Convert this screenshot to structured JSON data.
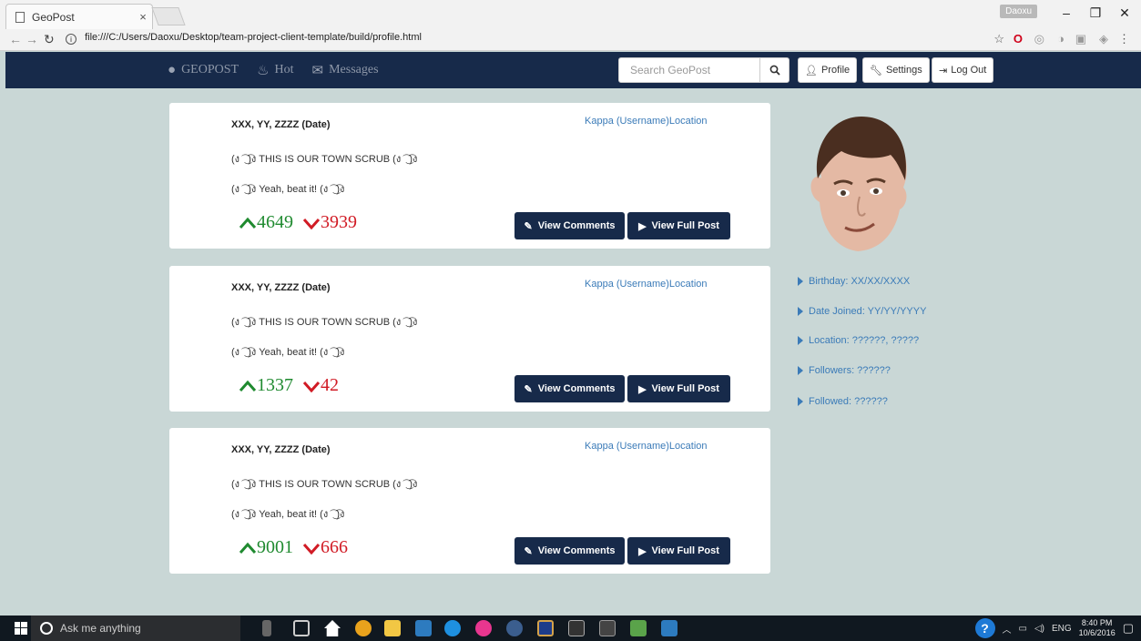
{
  "browser": {
    "tab_title": "GeoPost",
    "tab_close": "×",
    "url": "file:///C:/Users/Daoxu/Desktop/team-project-client-template/build/profile.html",
    "user_badge": "Daoxu"
  },
  "navbar": {
    "brand": "GEOPOST",
    "hot": "Hot",
    "messages": "Messages",
    "search_placeholder": "Search GeoPost",
    "profile": "Profile",
    "settings": "Settings",
    "logout": "Log Out"
  },
  "posts": [
    {
      "date": "XXX, YY, ZZZZ (Date)",
      "user": "Kappa (Username)Location",
      "line1": "(ง ͡ ͜ ͡)ง THIS IS OUR TOWN SCRUB (ง ͡ ͜ ͡)ง",
      "line2": "(ง ͡ ͜ ͡)ง Yeah, beat it! (ง ͡ ͜ ͡)ง",
      "upvotes": "4649",
      "downvotes": "3939",
      "view_comments": "View Comments",
      "view_full_post": "View Full Post"
    },
    {
      "date": "XXX, YY, ZZZZ (Date)",
      "user": "Kappa (Username)Location",
      "line1": "(ง ͡ ͜ ͡)ง THIS IS OUR TOWN SCRUB (ง ͡ ͜ ͡)ง",
      "line2": "(ง ͡ ͜ ͡)ง Yeah, beat it! (ง ͡ ͜ ͡)ง",
      "upvotes": "1337",
      "downvotes": "42",
      "view_comments": "View Comments",
      "view_full_post": "View Full Post"
    },
    {
      "date": "XXX, YY, ZZZZ (Date)",
      "user": "Kappa (Username)Location",
      "line1": "(ง ͡ ͜ ͡)ง THIS IS OUR TOWN SCRUB (ง ͡ ͜ ͡)ง",
      "line2": "(ง ͡ ͜ ͡)ง Yeah, beat it! (ง ͡ ͜ ͡)ง",
      "upvotes": "9001",
      "downvotes": "666",
      "view_comments": "View Comments",
      "view_full_post": "View Full Post"
    }
  ],
  "profile_info": [
    "Birthday: XX/XX/XXXX",
    "Date Joined: YY/YY/YYYY",
    "Location: ??????, ?????",
    "Followers: ??????",
    "Followed: ??????"
  ],
  "taskbar": {
    "search_text": "Ask me anything",
    "lang": "ENG",
    "time": "8:40 PM",
    "date": "10/6/2016"
  },
  "colors": {
    "navbar": "#172a4a",
    "background": "#c9d7d6",
    "link": "#3b7bb8",
    "upvote": "#1f8a2f",
    "downvote": "#d11b25"
  }
}
